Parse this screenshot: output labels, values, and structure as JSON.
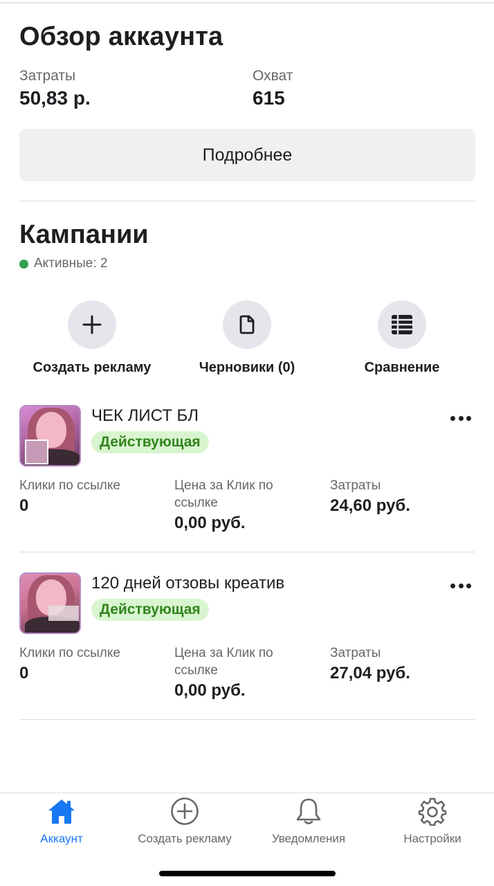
{
  "overview": {
    "title": "Обзор аккаунта",
    "spend_label": "Затраты",
    "spend_value": "50,83 р.",
    "reach_label": "Охват",
    "reach_value": "615",
    "more_button": "Подробнее"
  },
  "campaigns_section": {
    "title": "Кампании",
    "active_label": "Активные: 2",
    "active_color": "#31a24c",
    "actions": [
      {
        "label": "Создать рекламу",
        "icon": "plus-icon"
      },
      {
        "label": "Черновики (0)",
        "icon": "document-icon"
      },
      {
        "label": "Сравнение",
        "icon": "table-icon"
      }
    ]
  },
  "campaigns": [
    {
      "name": "ЧЕК ЛИСТ БЛ",
      "status": "Действующая",
      "clicks_label": "Клики по ссылке",
      "clicks_value": "0",
      "cpc_label": "Цена за Клик по ссылке",
      "cpc_value": "0,00 руб.",
      "spend_label": "Затраты",
      "spend_value": "24,60 руб."
    },
    {
      "name": "120 дней отзовы креатив",
      "status": "Действующая",
      "clicks_label": "Клики по ссылке",
      "clicks_value": "0",
      "cpc_label": "Цена за Клик по ссылке",
      "cpc_value": "0,00 руб.",
      "spend_label": "Затраты",
      "spend_value": "27,04 руб."
    }
  ],
  "bottom_nav": [
    {
      "label": "Аккаунт",
      "icon": "home-icon",
      "active": true
    },
    {
      "label": "Создать рекламу",
      "icon": "plus-circle-icon",
      "active": false
    },
    {
      "label": "Уведомления",
      "icon": "bell-icon",
      "active": false
    },
    {
      "label": "Настройки",
      "icon": "gear-icon",
      "active": false
    }
  ],
  "colors": {
    "accent": "#1877f2",
    "status_badge_bg": "#d9f5d0",
    "status_badge_text": "#31841d"
  }
}
